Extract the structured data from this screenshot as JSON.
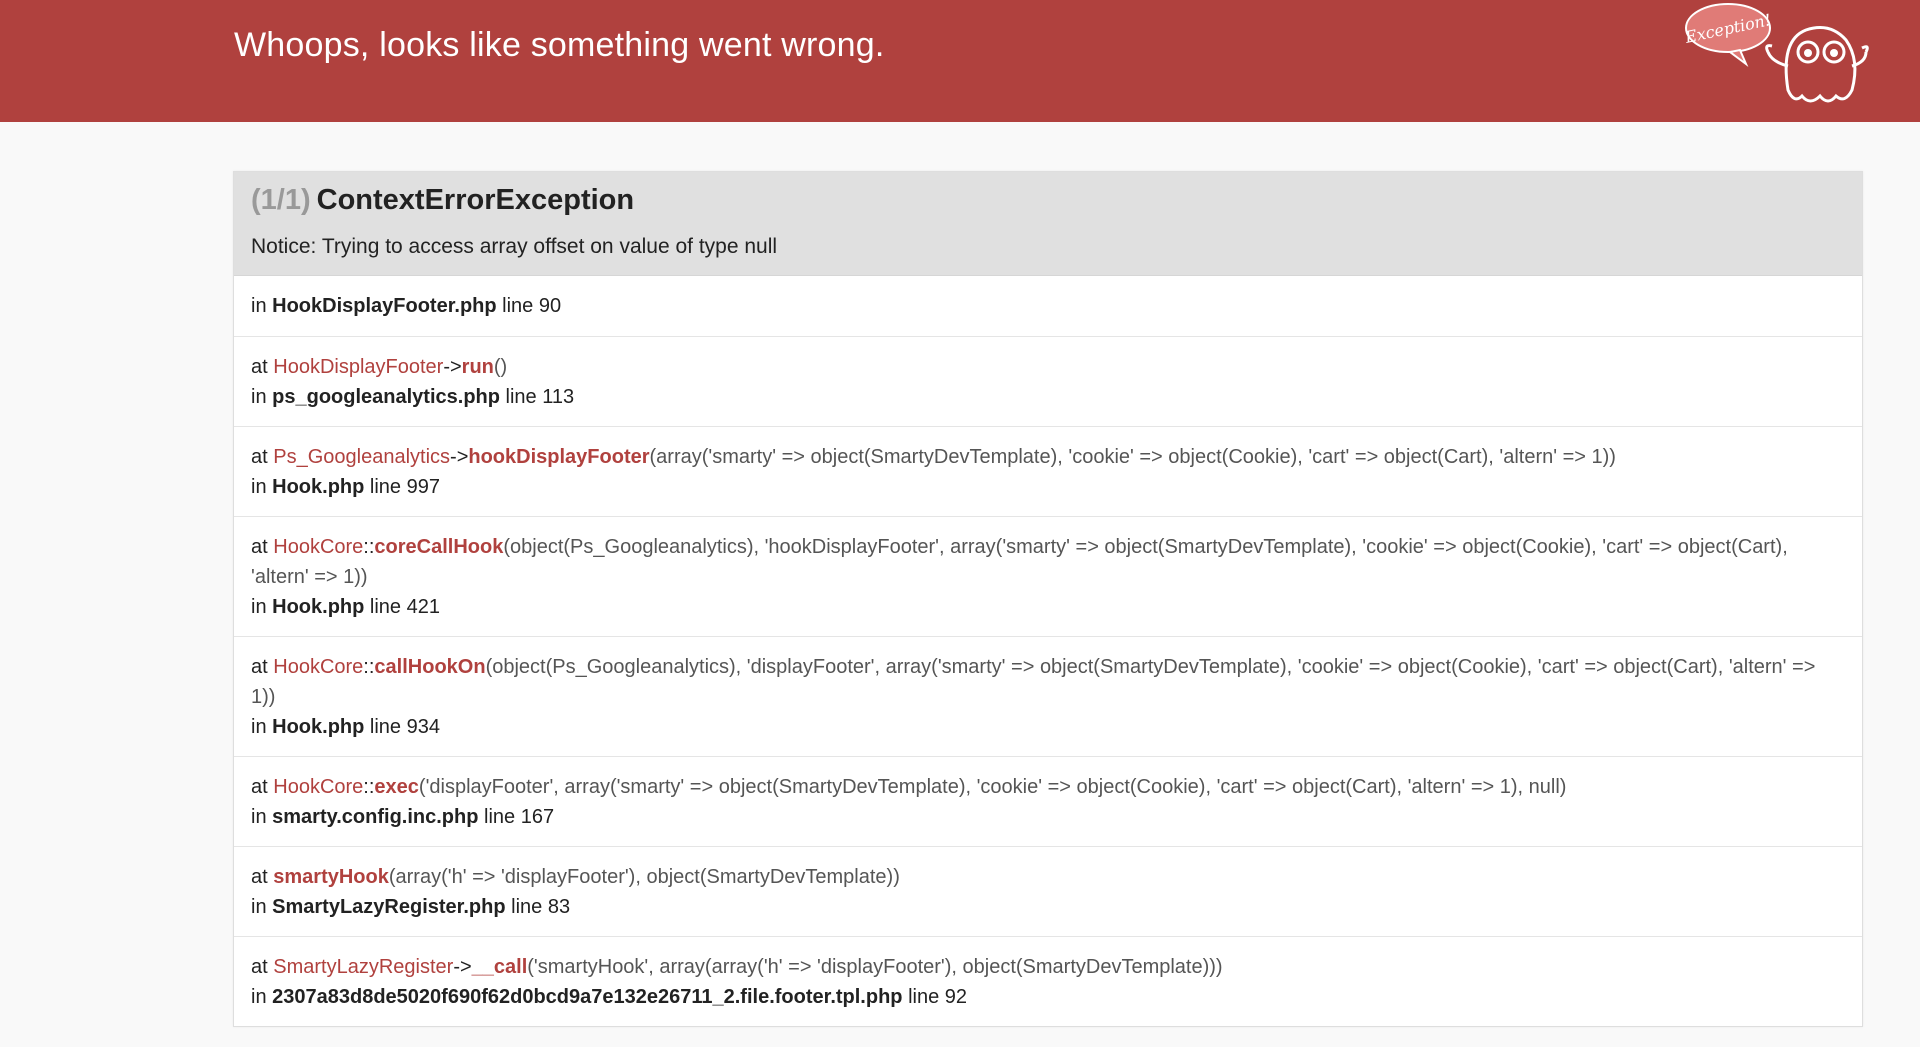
{
  "header": {
    "title": "Whoops, looks like something went wrong.",
    "badge": "Exception!"
  },
  "exception": {
    "count": "(1/1)",
    "name": "ContextErrorException",
    "message": "Notice: Trying to access array offset on value of type null"
  },
  "trace": [
    {
      "in": "in",
      "file": "HookDisplayFooter.php",
      "line": "line 90"
    },
    {
      "at": "at",
      "class": "HookDisplayFooter",
      "op": "->",
      "fn": "run",
      "args": "()",
      "in": "in",
      "file": "ps_googleanalytics.php",
      "line": "line 113"
    },
    {
      "at": "at",
      "class": "Ps_Googleanalytics",
      "op": "->",
      "fn": "hookDisplayFooter",
      "args": "(array('smarty' => object(SmartyDevTemplate), 'cookie' => object(Cookie), 'cart' => object(Cart), 'altern' => 1))",
      "in": "in",
      "file": "Hook.php",
      "line": "line 997"
    },
    {
      "at": "at",
      "class": "HookCore",
      "op": "::",
      "fn": "coreCallHook",
      "args": "(object(Ps_Googleanalytics), 'hookDisplayFooter', array('smarty' => object(SmartyDevTemplate), 'cookie' => object(Cookie), 'cart' => object(Cart), 'altern' => 1))",
      "in": "in",
      "file": "Hook.php",
      "line": "line 421"
    },
    {
      "at": "at",
      "class": "HookCore",
      "op": "::",
      "fn": "callHookOn",
      "args": "(object(Ps_Googleanalytics), 'displayFooter', array('smarty' => object(SmartyDevTemplate), 'cookie' => object(Cookie), 'cart' => object(Cart), 'altern' => 1))",
      "in": "in",
      "file": "Hook.php",
      "line": "line 934"
    },
    {
      "at": "at",
      "class": "HookCore",
      "op": "::",
      "fn": "exec",
      "args": "('displayFooter', array('smarty' => object(SmartyDevTemplate), 'cookie' => object(Cookie), 'cart' => object(Cart), 'altern' => 1), null)",
      "in": "in",
      "file": "smarty.config.inc.php",
      "line": "line 167"
    },
    {
      "at": "at",
      "class": "",
      "op": "",
      "fn": "smartyHook",
      "args": "(array('h' => 'displayFooter'), object(SmartyDevTemplate))",
      "in": "in",
      "file": "SmartyLazyRegister.php",
      "line": "line 83"
    },
    {
      "at": "at",
      "class": "SmartyLazyRegister",
      "op": "->",
      "fn": "__call",
      "args": "('smartyHook', array(array('h' => 'displayFooter'), object(SmartyDevTemplate)))",
      "in": "in",
      "file": "2307a83d8de5020f690f62d0bcd9a7e132e26711_2.file.footer.tpl.php",
      "line": "line 92"
    }
  ],
  "colors": {
    "header_bg": "#b0413e",
    "accent": "#b0413e",
    "panel_head_bg": "#e0e0e0"
  }
}
